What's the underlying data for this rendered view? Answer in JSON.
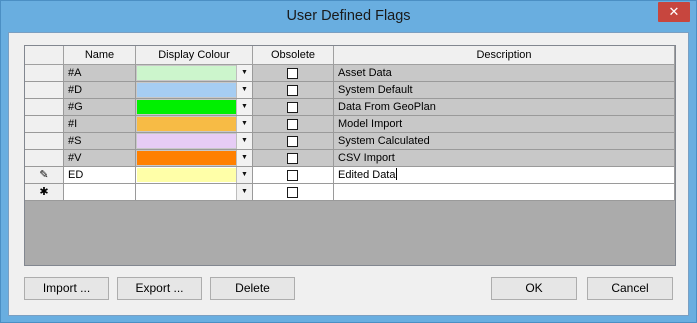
{
  "window": {
    "title": "User Defined Flags",
    "close_glyph": "✕"
  },
  "table": {
    "columns": [
      "Name",
      "Display Colour",
      "Obsolete",
      "Description"
    ],
    "rows": [
      {
        "name": "#A",
        "colour": "#ccf5cc",
        "obsolete": false,
        "description": "Asset Data"
      },
      {
        "name": "#D",
        "colour": "#a6cdf2",
        "obsolete": false,
        "description": "System Default"
      },
      {
        "name": "#G",
        "colour": "#00f000",
        "obsolete": false,
        "description": "Data From GeoPlan"
      },
      {
        "name": "#I",
        "colour": "#f7bb45",
        "obsolete": false,
        "description": "Model Import"
      },
      {
        "name": "#S",
        "colour": "#e6ccf5",
        "obsolete": false,
        "description": "System Calculated"
      },
      {
        "name": "#V",
        "colour": "#ff8000",
        "obsolete": false,
        "description": "CSV Import"
      }
    ],
    "edit_row": {
      "indicator": "✎",
      "name": "ED",
      "colour": "#ffffa8",
      "obsolete": false,
      "description": "Edited Data"
    },
    "new_row": {
      "indicator": "✱",
      "name": "",
      "description": ""
    },
    "dropdown_glyph": "▼"
  },
  "buttons": {
    "import": "Import ...",
    "export": "Export ...",
    "delete": "Delete",
    "ok": "OK",
    "cancel": "Cancel"
  }
}
